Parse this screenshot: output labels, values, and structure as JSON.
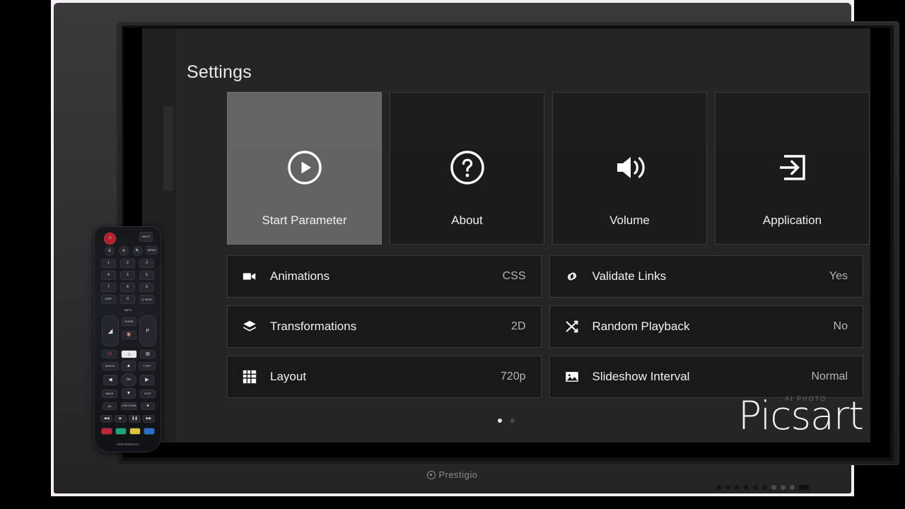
{
  "screen": {
    "page_title": "Settings",
    "tiles": [
      {
        "label": "Start Parameter",
        "icon": "play-circle-icon",
        "selected": true
      },
      {
        "label": "About",
        "icon": "help-circle-icon",
        "selected": false
      },
      {
        "label": "Volume",
        "icon": "volume-icon",
        "selected": false
      },
      {
        "label": "Application",
        "icon": "app-input-icon",
        "selected": false
      }
    ],
    "rows": [
      {
        "label": "Animations",
        "value": "CSS",
        "icon": "video-camera-icon"
      },
      {
        "label": "Validate Links",
        "value": "Yes",
        "icon": "link-icon"
      },
      {
        "label": "Transformations",
        "value": "2D",
        "icon": "layers-icon"
      },
      {
        "label": "Random Playback",
        "value": "No",
        "icon": "shuffle-icon"
      },
      {
        "label": "Layout",
        "value": "720p",
        "icon": "grid-icon"
      },
      {
        "label": "Slideshow Interval",
        "value": "Normal",
        "icon": "image-icon"
      }
    ],
    "pagination": {
      "count": 2,
      "active_index": 0
    },
    "watermark": {
      "main": "Picsart",
      "sub": "AI PHOTO"
    },
    "colors": {
      "background": "#252525",
      "selected_tile": "#636363",
      "row_background": "#191919",
      "text": "#f2f2f2",
      "value_text": "#b6b6b6"
    }
  },
  "tv": {
    "brand": "Prestigio"
  },
  "remote": {
    "model": "AKB75095312",
    "buttons": [
      {
        "label": "",
        "name": "power-button"
      },
      {
        "label": "INPUT",
        "name": "input-button"
      },
      {
        "label": "",
        "name": "subtitle-button"
      },
      {
        "label": "",
        "name": "settings-gear-button"
      },
      {
        "label": "",
        "name": "search-button"
      },
      {
        "label": "MENU",
        "name": "menu-button"
      },
      {
        "label": "1",
        "name": "digit-1-button"
      },
      {
        "label": "2",
        "name": "digit-2-button"
      },
      {
        "label": "3",
        "name": "digit-3-button"
      },
      {
        "label": "4",
        "name": "digit-4-button"
      },
      {
        "label": "5",
        "name": "digit-5-button"
      },
      {
        "label": "6",
        "name": "digit-6-button"
      },
      {
        "label": "7",
        "name": "digit-7-button"
      },
      {
        "label": "8",
        "name": "digit-8-button"
      },
      {
        "label": "9",
        "name": "digit-9-button"
      },
      {
        "label": "LIST",
        "name": "list-button"
      },
      {
        "label": "0",
        "name": "digit-0-button"
      },
      {
        "label": "Q.VIEW",
        "name": "quick-view-button"
      },
      {
        "label": "INFO",
        "name": "info-button"
      },
      {
        "label": "GUIDE",
        "name": "guide-button"
      },
      {
        "label": "P",
        "name": "page-button"
      },
      {
        "label": "[V]",
        "name": "volume-label-button"
      },
      {
        "label": "",
        "name": "home-button"
      },
      {
        "label": "",
        "name": "subtitle2-button"
      },
      {
        "label": "IBTEXT",
        "name": "text-button"
      },
      {
        "label": "T.OPT",
        "name": "text-option-button"
      },
      {
        "label": "OK",
        "name": "ok-button"
      },
      {
        "label": "BACK",
        "name": "back-button"
      },
      {
        "label": "EXIT",
        "name": "exit-button"
      },
      {
        "label": "AD",
        "name": "audio-description-button"
      },
      {
        "label": "LIVE ZOOM",
        "name": "live-zoom-button"
      },
      {
        "label": "",
        "name": "stop-button"
      },
      {
        "label": "",
        "name": "rewind-button"
      },
      {
        "label": "",
        "name": "play-button"
      },
      {
        "label": "",
        "name": "pause-button"
      },
      {
        "label": "",
        "name": "fast-forward-button"
      }
    ]
  }
}
